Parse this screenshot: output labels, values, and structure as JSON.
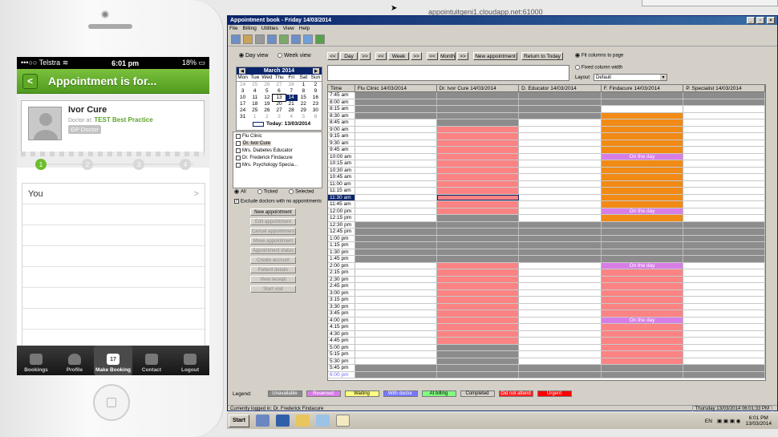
{
  "phone": {
    "status": {
      "carrier": "Telstra",
      "time": "6:01 pm",
      "battery": "18%"
    },
    "nav_title": "Appointment is for...",
    "back_label": "<",
    "doctor": {
      "name": "Ivor Cure",
      "role_prefix": "Doctor at:",
      "practice": "TEST Best Practice",
      "type": "GP Doctor"
    },
    "steps": [
      "1",
      "2",
      "3",
      "4"
    ],
    "list_rows": [
      {
        "label": "You",
        "chevron": ">"
      },
      {
        "label": "",
        "chevron": ""
      },
      {
        "label": "",
        "chevron": ""
      },
      {
        "label": "",
        "chevron": ""
      },
      {
        "label": "",
        "chevron": ""
      },
      {
        "label": "",
        "chevron": ""
      },
      {
        "label": "",
        "chevron": ""
      },
      {
        "label": "",
        "chevron": ""
      }
    ],
    "tabs": [
      {
        "label": "Bookings",
        "icon": "list-icon"
      },
      {
        "label": "Profile",
        "icon": "person-icon"
      },
      {
        "label": "Make Booking",
        "icon": "calendar-icon",
        "day": "17"
      },
      {
        "label": "Contact",
        "icon": "chat-icon"
      },
      {
        "label": "Logout",
        "icon": "lock-icon"
      }
    ]
  },
  "remote_title": "appointuitgeni1.cloudapp.net:61000",
  "window": {
    "title": "Appointment book - Friday 14/03/2014",
    "menu": [
      "File",
      "Billing",
      "Utilities",
      "View",
      "Help"
    ],
    "view_options": {
      "day": "Day view",
      "week": "Week view"
    },
    "nav_buttons": {
      "prev": "<<",
      "next": ">>",
      "day": "Day",
      "week": "Week",
      "month": "Month",
      "new_appt": "New appointment",
      "today": "Return to Today"
    },
    "fit_options": {
      "fit": "Fit columns to page",
      "fixed": "Fixed column width"
    },
    "layout_label": "Layout",
    "layout_value": "Default",
    "calendar": {
      "month": "March 2014",
      "days": [
        "Mon",
        "Tue",
        "Wed",
        "Thu",
        "Fri",
        "Sat",
        "Sun"
      ],
      "dates": [
        "24",
        "25",
        "26",
        "27",
        "28",
        "1",
        "2",
        "3",
        "4",
        "5",
        "6",
        "7",
        "8",
        "9",
        "10",
        "11",
        "12",
        "13",
        "14",
        "15",
        "16",
        "17",
        "18",
        "19",
        "20",
        "21",
        "22",
        "23",
        "24",
        "25",
        "26",
        "27",
        "28",
        "29",
        "30",
        "31",
        "1",
        "2",
        "3",
        "4",
        "5",
        "6"
      ],
      "today_label": "Today: 13/03/2014"
    },
    "doctors": [
      "Flu Clinic",
      "Dr. Ivor Cure",
      "Mrs. Diabetes Educator",
      "Dr. Frederick Findacure",
      "Mrs. Psychology Specia..."
    ],
    "filter": {
      "all": "All",
      "ticked": "Ticked",
      "selected": "Selected",
      "exclude": "Exclude doctors with no appointments"
    },
    "side_buttons": [
      "New appointment",
      "Edit appointment",
      "Cancel appointment",
      "Move appointment",
      "Appointment status",
      "Create account",
      "Patient details",
      "View receipt",
      "Start visit"
    ],
    "columns": [
      "Time",
      "Flu Clinic  14/03/2014",
      "Dr. Ivor Cure  14/03/2014",
      "D. Educator  14/03/2014",
      "F. Findacure  14/03/2014",
      "P. Specialist  14/03/2014"
    ],
    "times": [
      "7:45 am",
      "8:00 am",
      "8:15 am",
      "8:30 am",
      "8:45 am",
      "9:00 am",
      "9:15 am",
      "9:30 am",
      "9:45 am",
      "10:00 am",
      "10:15 am",
      "10:30 am",
      "10:45 am",
      "11:00 am",
      "11:15 am",
      "11:30 am",
      "11:45 am",
      "12:00 pm",
      "12:15 pm",
      "12:30 pm",
      "12:45 pm",
      "1:00 pm",
      "1:15 pm",
      "1:30 pm",
      "1:45 pm",
      "2:00 pm",
      "2:15 pm",
      "2:30 pm",
      "2:45 pm",
      "3:00 pm",
      "3:15 pm",
      "3:30 pm",
      "3:45 pm",
      "4:00 pm",
      "4:15 pm",
      "4:30 pm",
      "4:45 pm",
      "5:00 pm",
      "5:15 pm",
      "5:30 pm",
      "5:45 pm",
      "6:00 pm"
    ],
    "selected_time": "11:30 am",
    "on_the_day": "On the day",
    "legend_label": "Legend:",
    "legend": [
      {
        "label": "Unavailable",
        "color": "#8c8c8c"
      },
      {
        "label": "Reserved",
        "color": "#d77ee6"
      },
      {
        "label": "Waiting",
        "color": "#ffff80"
      },
      {
        "label": "With doctor",
        "color": "#7878ff"
      },
      {
        "label": "At billing",
        "color": "#80ff80"
      },
      {
        "label": "Completed",
        "color": "#d4d0c8"
      },
      {
        "label": "Did not attend",
        "color": "#ff2020"
      },
      {
        "label": "Urgent",
        "color": "#ff0000"
      }
    ],
    "status_left": "Currently logged in:  Dr. Frederick Findacure",
    "status_right": "Thursday 13/03/2014 06:01:33 PM"
  },
  "taskbar": {
    "start": "Start",
    "lang": "EN",
    "time": "6:01 PM",
    "date": "13/03/2014"
  }
}
